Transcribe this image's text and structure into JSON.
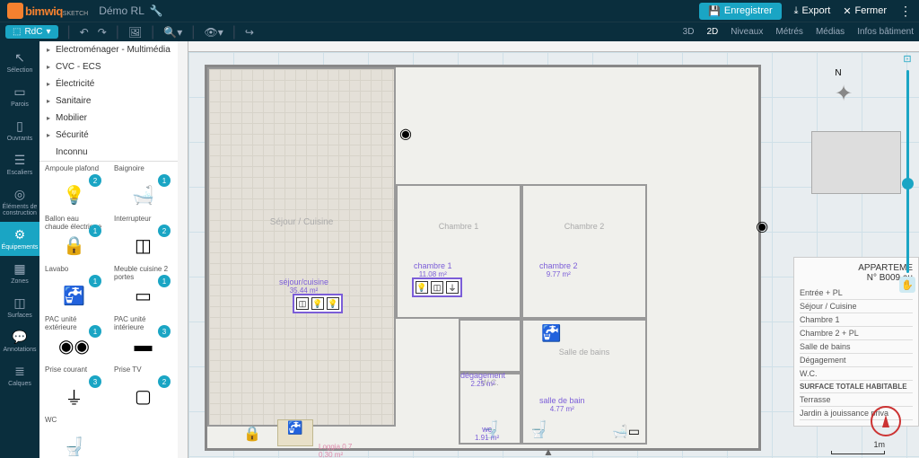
{
  "header": {
    "logo_text": "bimwiq",
    "logo_sub": "SKETCH",
    "project": "Démo RL",
    "save": "Enregistrer",
    "export": "Export",
    "close": "Fermer"
  },
  "toolbar": {
    "floor": "RdC",
    "views": {
      "v3d": "3D",
      "v2d": "2D",
      "niveaux": "Niveaux",
      "metres": "Métrés",
      "medias": "Médias",
      "infos": "Infos bâtiment"
    }
  },
  "rail": {
    "selection": "Sélection",
    "parois": "Parois",
    "ouvrants": "Ouvrants",
    "escaliers": "Escaliers",
    "elements": "Éléments de construction",
    "equipements": "Équipements",
    "zones": "Zones",
    "surfaces": "Surfaces",
    "annotations": "Annotations",
    "calques": "Calques"
  },
  "categories": [
    "Electroménager - Multimédia",
    "CVC - ECS",
    "Électricité",
    "Sanitaire",
    "Mobilier",
    "Sécurité",
    "Inconnu"
  ],
  "equip": {
    "ampoule": "Ampoule plafond",
    "baignoire": "Baignoire",
    "ballon": "Ballon eau chaude électrique",
    "interrupteur": "Interrupteur",
    "lavabo": "Lavabo",
    "meuble": "Meuble cuisine 2 portes",
    "pac_ext": "PAC unité extérieure",
    "pac_int": "PAC unité intérieure",
    "prise": "Prise courant",
    "prise_tv": "Prise TV",
    "wc": "WC"
  },
  "badges": {
    "ampoule": "2",
    "baignoire": "1",
    "ballon": "1",
    "interrupteur": "2",
    "lavabo": "1",
    "meuble": "1",
    "pac_ext": "1",
    "pac_int": "3",
    "prise": "3",
    "prise_tv": "2"
  },
  "rooms": {
    "terrasse": "Terrasse",
    "sejour": "séjour/cuisine",
    "sejour_a": "35.44 m²",
    "ch1": "chambre 1",
    "ch1_a": "11.08 m²",
    "ch2": "chambre 2",
    "ch2_a": "9.77 m²",
    "deg": "dégagement",
    "deg_a": "2.25 m²",
    "bain": "salle de bain",
    "bain_a": "4.77 m²",
    "wc": "wc",
    "wc_a": "1.91 m²",
    "entree": "Entrée",
    "loggia": "Loggia 0.7",
    "loggia_a": "0.30 m²",
    "sejour_label": "Séjour / Cuisine",
    "ch1_label": "Chambre 1",
    "ch2_label": "Chambre 2",
    "bain_label": "Salle de bains",
    "wc_label": "W.C."
  },
  "info": {
    "title1": "APPARTEME",
    "title2": "N° B009 au",
    "r1": "Entrée + PL",
    "r2": "Séjour / Cuisine",
    "r3": "Chambre 1",
    "r4": "Chambre 2 + PL",
    "r5": "Salle de bains",
    "r6": "Dégagement",
    "r7": "W.C.",
    "surf": "SURFACE TOTALE HABITABLE",
    "r8": "Terrasse",
    "r9": "Jardin à jouissance priva"
  },
  "scale": "1m",
  "compass_n": "N"
}
